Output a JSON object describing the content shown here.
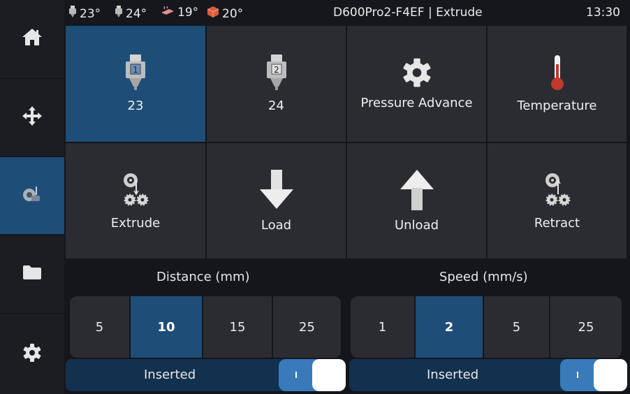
{
  "topbar": {
    "temps": [
      {
        "icon": "nozzle-1-icon",
        "value": "23°"
      },
      {
        "icon": "nozzle-2-icon",
        "value": "24°"
      },
      {
        "icon": "heated-bed-icon",
        "value": "19°"
      },
      {
        "icon": "chamber-icon",
        "value": "20°"
      }
    ],
    "title": "D600Pro2-F4EF | Extrude",
    "clock": "13:30"
  },
  "sidebar": {
    "items": [
      {
        "icon": "home-icon",
        "active": false
      },
      {
        "icon": "move-icon",
        "active": false
      },
      {
        "icon": "extrude-icon",
        "active": true
      },
      {
        "icon": "folder-icon",
        "active": false
      },
      {
        "icon": "gear-icon",
        "active": false
      }
    ]
  },
  "tiles": [
    {
      "label": "23",
      "icon": "extruder-1-icon",
      "active": true
    },
    {
      "label": "24",
      "icon": "extruder-2-icon",
      "active": false
    },
    {
      "label": "Pressure Advance",
      "icon": "gear-icon",
      "active": false
    },
    {
      "label": "Temperature",
      "icon": "thermometer-icon",
      "active": false
    },
    {
      "label": "Extrude",
      "icon": "extrude-gears-icon",
      "active": false
    },
    {
      "label": "Load",
      "icon": "arrow-down-icon",
      "active": false
    },
    {
      "label": "Unload",
      "icon": "arrow-up-icon",
      "active": false
    },
    {
      "label": "Retract",
      "icon": "retract-gears-icon",
      "active": false
    }
  ],
  "distance": {
    "label": "Distance (mm)",
    "options": [
      "5",
      "10",
      "15",
      "25"
    ],
    "selected": "10"
  },
  "speed": {
    "label": "Speed (mm/s)",
    "options": [
      "1",
      "2",
      "5",
      "25"
    ],
    "selected": "2"
  },
  "sensors": [
    {
      "label": "Inserted",
      "enabled": true
    },
    {
      "label": "Inserted",
      "enabled": true
    }
  ],
  "colors": {
    "accent": "#1e4d78",
    "tile": "#2a2c31",
    "background": "#14161b",
    "toggle_on": "#3a7ab8"
  }
}
